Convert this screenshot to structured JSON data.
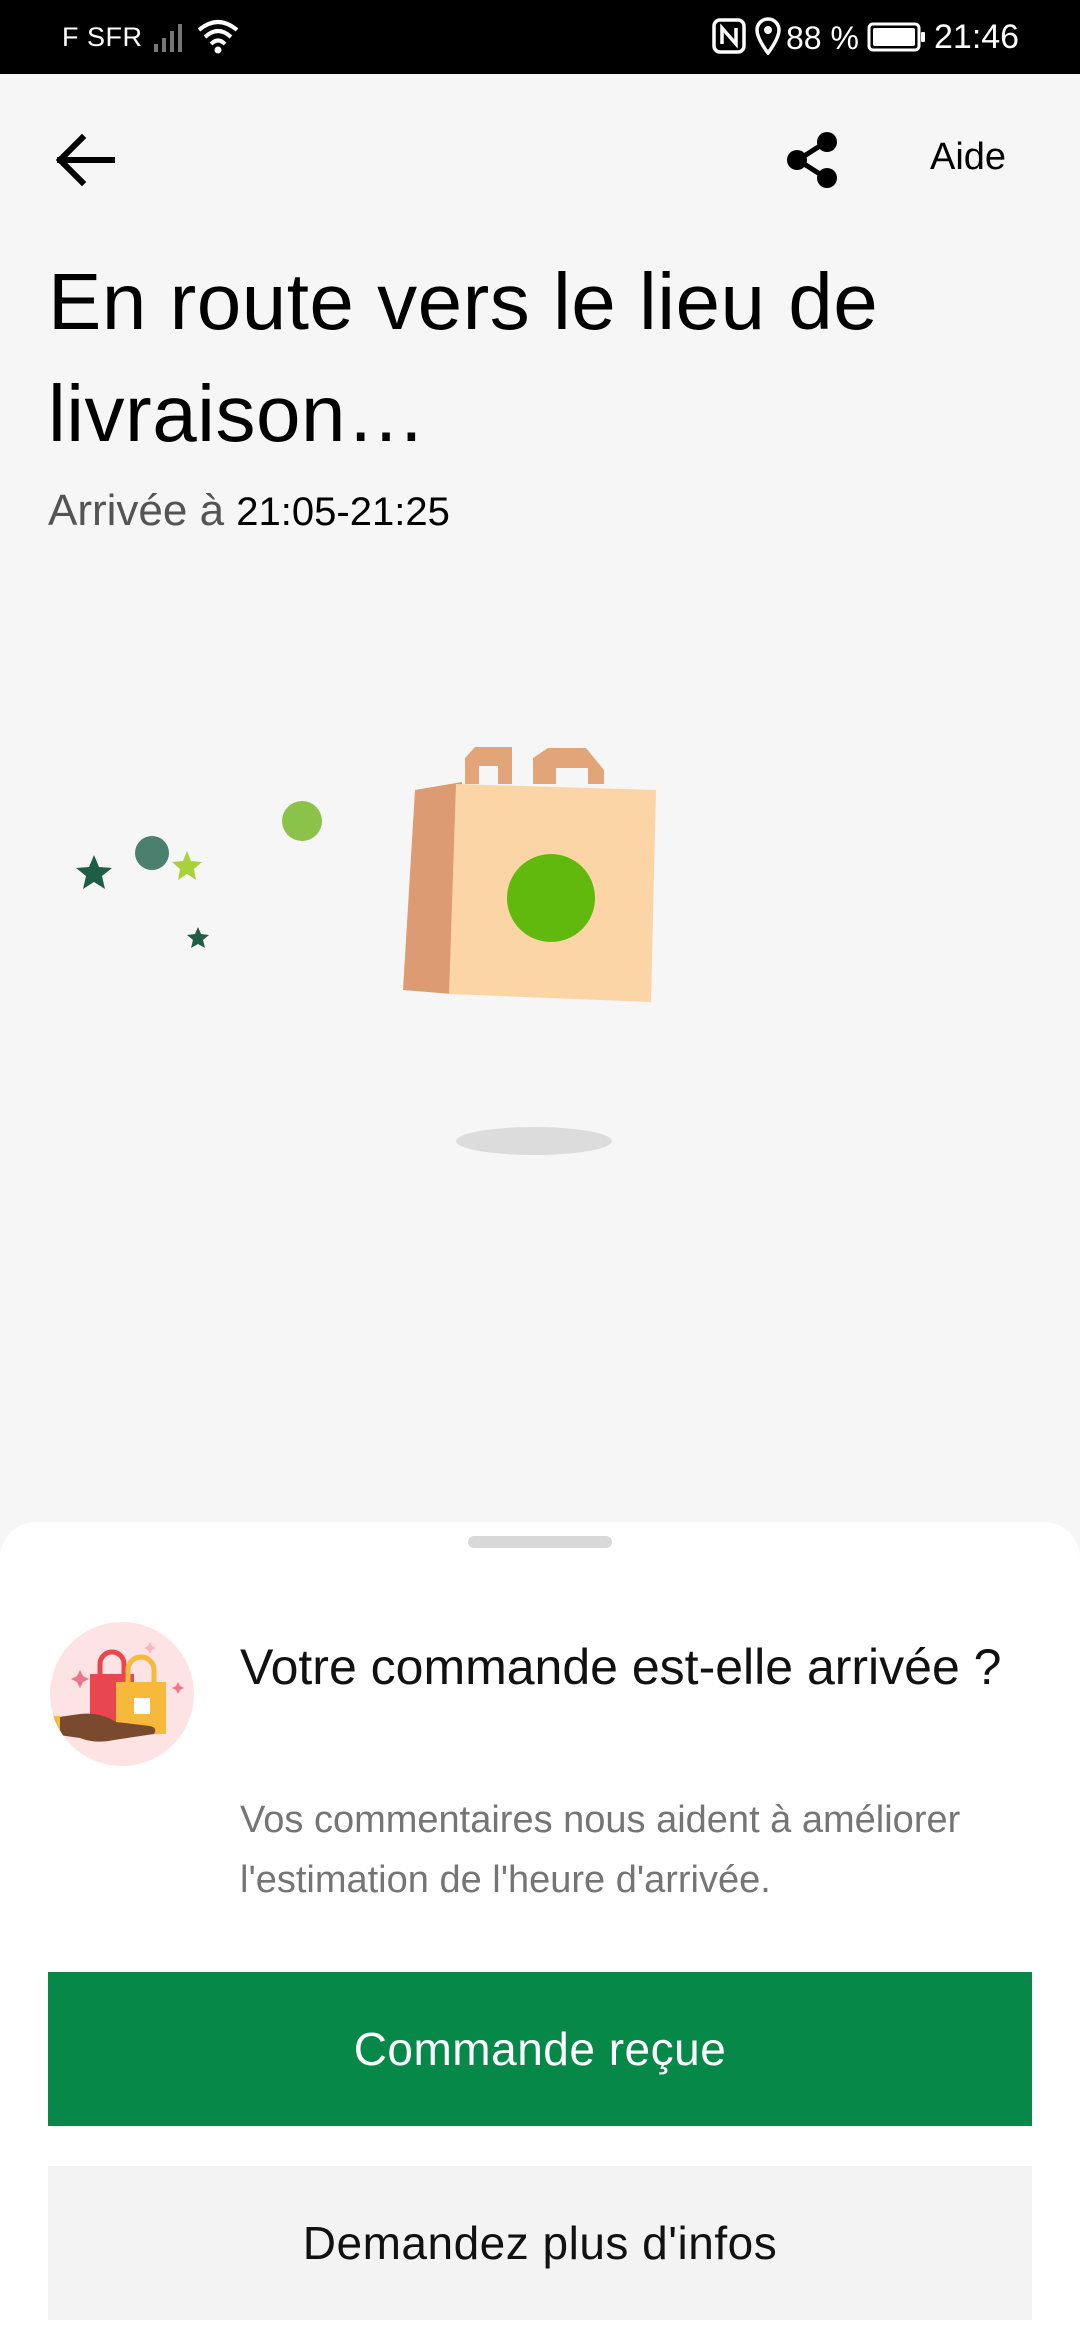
{
  "status_bar": {
    "carrier": "F SFR",
    "battery_percent": "88 %",
    "time": "21:46",
    "icons": [
      "signal-icon",
      "wifi-icon",
      "nfc-icon",
      "location-icon",
      "battery-icon"
    ]
  },
  "top_bar": {
    "back_icon": "arrow-left-icon",
    "share_icon": "share-icon",
    "help_label": "Aide"
  },
  "main": {
    "title": "En route vers le lieu de livraison…",
    "arrival_prefix": "Arrivée à ",
    "arrival_window": "21:05-21:25"
  },
  "illustration": {
    "description_icon": "shopping-bag-icon",
    "colors": {
      "bag_front": "#fcd5a6",
      "bag_side": "#dc9b72",
      "bag_handle": "#e2a578",
      "bag_dot": "#62b90e",
      "star_dark": "#1f5d47",
      "star_light": "#a8d13b",
      "dot_gray_green": "#4b7f6e",
      "dot_green": "#8bc34a",
      "shadow": "#dcdcdc"
    }
  },
  "feedback": {
    "question": "Votre commande est-elle arrivée ?",
    "hint": "Vos commentaires nous aident à améliorer l'estimation de l'heure d'arrivée.",
    "primary_button": "Commande reçue",
    "secondary_button": "Demandez plus d'infos",
    "colors": {
      "primary": "#058848",
      "secondary": "#f3f3f3"
    }
  }
}
